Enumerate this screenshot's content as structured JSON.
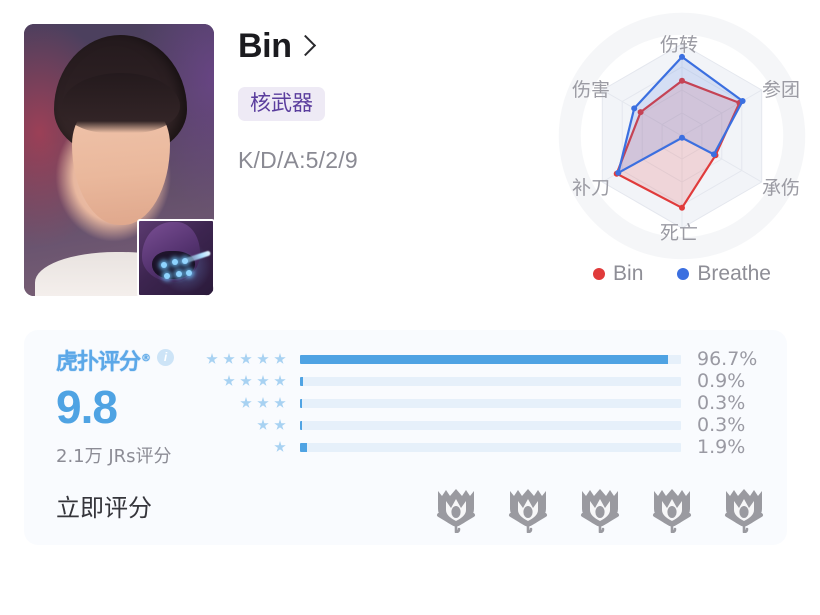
{
  "player": {
    "name": "Bin",
    "chevron_icon": "chevron-right-icon",
    "tag": "核武器",
    "kda": "K/D/A:5/2/9",
    "avatar_alt": "player-portrait",
    "champion_alt": "champion-kha-zix"
  },
  "radar": {
    "legend": [
      {
        "label": "Bin",
        "color": "#e03b3b"
      },
      {
        "label": "Breathe",
        "color": "#3b6fe0"
      }
    ],
    "axes": [
      "伤转",
      "参团",
      "承伤",
      "死亡",
      "补刀",
      "伤害"
    ]
  },
  "chart_data": {
    "type": "radar",
    "title": "",
    "categories": [
      "伤转",
      "参团",
      "承伤",
      "死亡",
      "补刀",
      "伤害"
    ],
    "rmax": 1.0,
    "rings": 4,
    "grid": true,
    "legend_position": "bottom",
    "series": [
      {
        "name": "Bin",
        "color": "#e03b3b",
        "values": [
          0.6,
          0.72,
          0.42,
          0.78,
          0.82,
          0.52
        ]
      },
      {
        "name": "Breathe",
        "color": "#3b6fe0",
        "values": [
          0.86,
          0.76,
          0.4,
          0.02,
          0.8,
          0.6
        ]
      }
    ]
  },
  "rating": {
    "brand": "虎扑评分",
    "brand_reg": "®",
    "info_icon": "info-icon",
    "score": "9.8",
    "count_text": "2.1万 JRs评分",
    "distribution": [
      {
        "stars": 5,
        "percent": "96.7%",
        "value": 96.7
      },
      {
        "stars": 4,
        "percent": "0.9%",
        "value": 0.9
      },
      {
        "stars": 3,
        "percent": "0.3%",
        "value": 0.3
      },
      {
        "stars": 2,
        "percent": "0.3%",
        "value": 0.3
      },
      {
        "stars": 1,
        "percent": "1.9%",
        "value": 1.9
      }
    ],
    "rate_now_label": "立即评分",
    "rate_star_count": 5,
    "rate_star_icon": "worlds-trophy-icon"
  },
  "colors": {
    "accent_blue": "#4fa3e3",
    "bar_track": "#e6f0fa",
    "card_bg": "#f9fbfe",
    "tag_bg": "#eeeaf5",
    "tag_fg": "#5a3d9d",
    "series_red": "#e03b3b",
    "series_blue": "#3b6fe0"
  }
}
